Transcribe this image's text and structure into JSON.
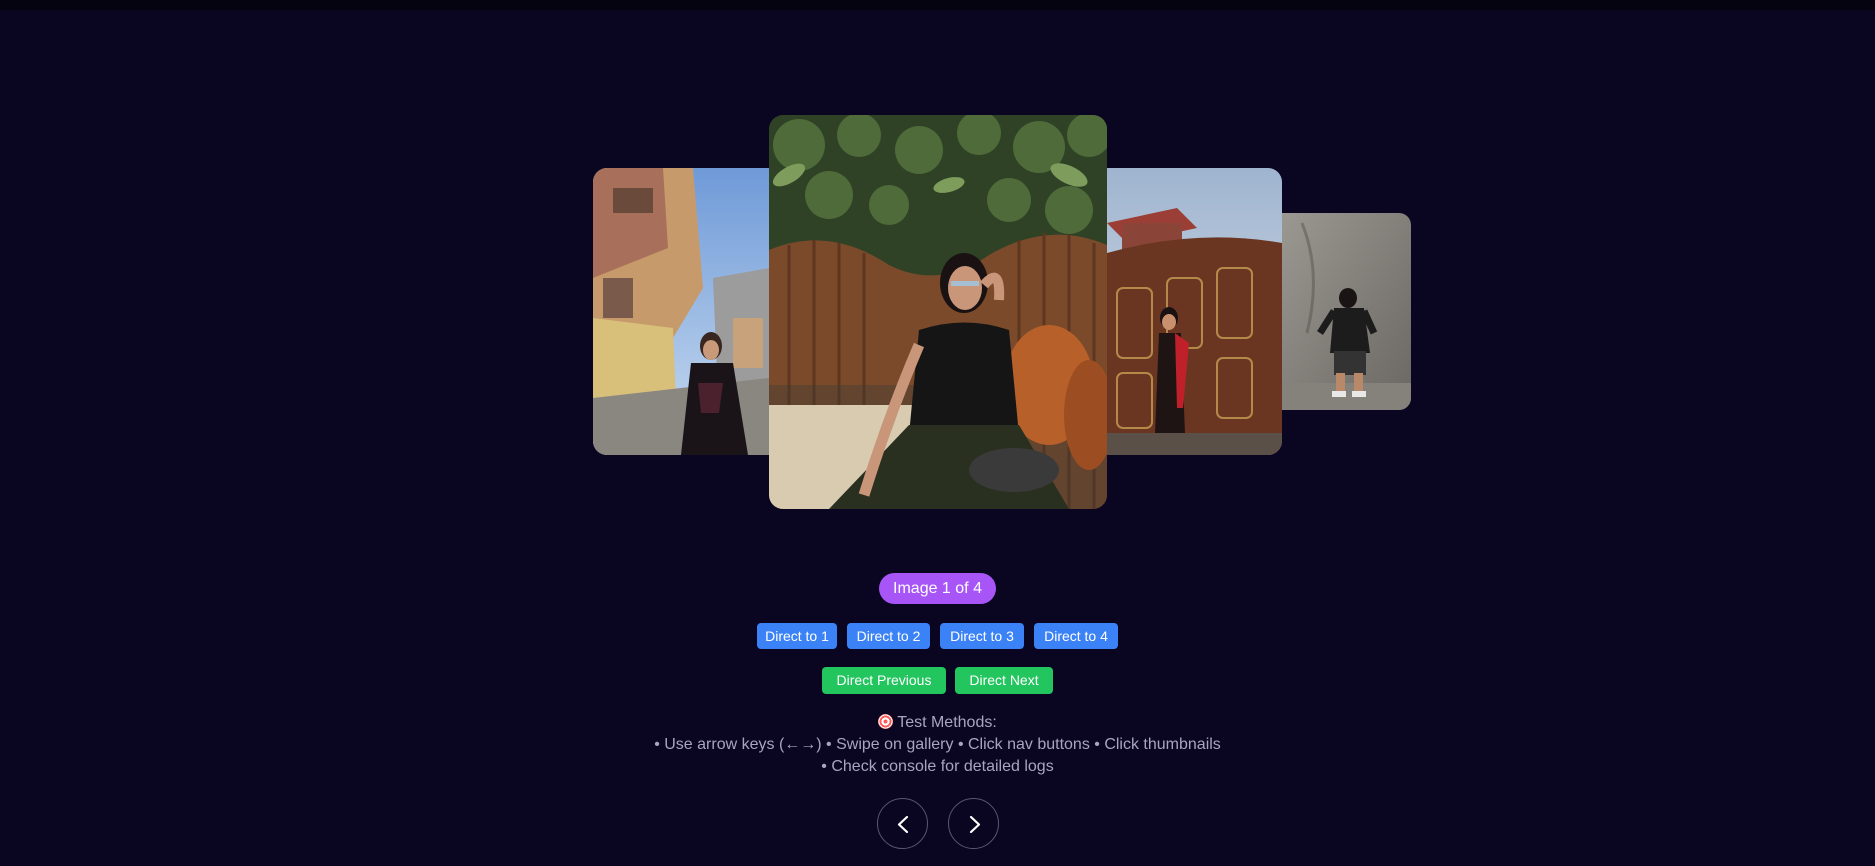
{
  "gallery": {
    "counter": "Image 1 of 4",
    "images": [
      {
        "position": "left",
        "description": "photo-woman-in-alley"
      },
      {
        "position": "center",
        "description": "photo-woman-on-sofa"
      },
      {
        "position": "right",
        "description": "photo-woman-at-gate"
      },
      {
        "position": "far-right",
        "description": "photo-man-at-wall"
      }
    ]
  },
  "buttons": {
    "direct": [
      "Direct to 1",
      "Direct to 2",
      "Direct to 3",
      "Direct to 4"
    ],
    "previous": "Direct Previous",
    "next": "Direct Next"
  },
  "instructions": {
    "title": "Test Methods:",
    "line1": "• Use arrow keys (←→) • Swipe on gallery • Click nav buttons • Click thumbnails",
    "line2": "• Check console for detailed logs"
  },
  "icons": {
    "title_icon": "dart-target-icon",
    "prev_icon": "chevron-left-icon",
    "next_icon": "chevron-right-icon"
  },
  "colors": {
    "background": "#0a0520",
    "counter_badge": "#a855f7",
    "direct_button": "#3b82f6",
    "nav_button": "#22c55e"
  }
}
